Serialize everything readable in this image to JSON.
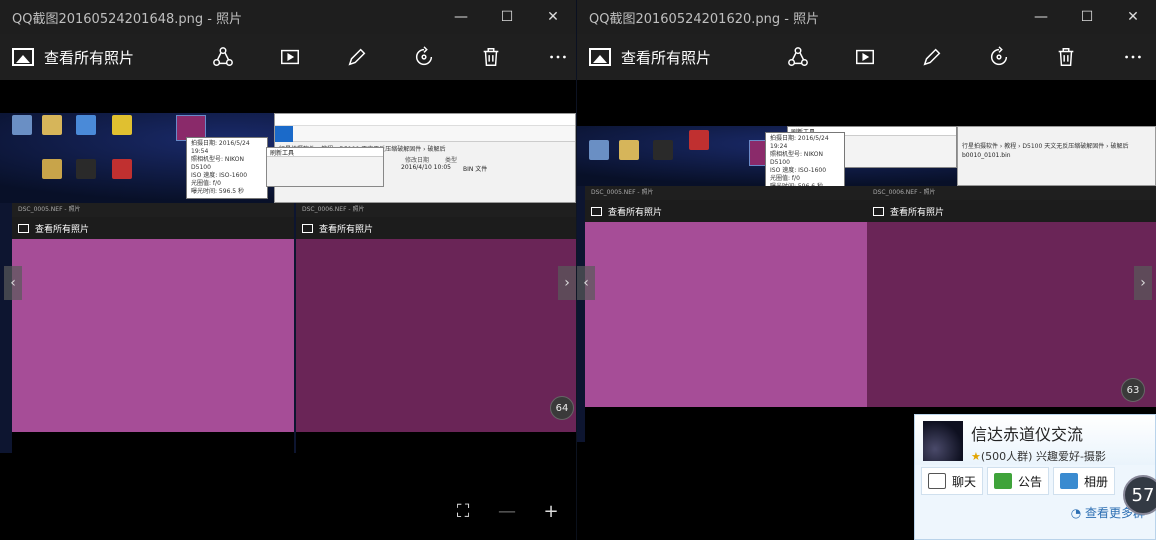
{
  "left_window": {
    "title": "QQ截图20160524201648.png - 照片",
    "all_photos_label": "查看所有照片",
    "counter": "64",
    "zoom_controls": [
      "fit-icon",
      "zoom-out-icon",
      "zoom-in-icon"
    ]
  },
  "right_window": {
    "title": "QQ截图20160524201620.png - 照片",
    "all_photos_label": "查看所有照片",
    "counter": "63"
  },
  "toolbar_icons": [
    "share-icon",
    "slideshow-icon",
    "edit-icon",
    "rotate-icon",
    "delete-icon",
    "more-icon"
  ],
  "embedded": {
    "left_info": [
      "拍摄日期: 2016/5/24 19:54",
      "照相机型号: NIKON D5100",
      "ISO 速度: ISO-1600",
      "光圈值: f/0",
      "曝光时间: 596.5 秒"
    ],
    "right_info": [
      "拍摄日期: 2016/5/24 19:24",
      "照相机型号: NIKON D5100",
      "ISO 速度: ISO-1600",
      "光圈值: f/0",
      "曝光时间: 596.6 秒"
    ],
    "mini_left_title": "DSC_0005.NEF - 照片",
    "mini_right_title": "DSC_0006.NEF - 照片",
    "mini_label": "查看所有照片",
    "explorer_path": "行星拍摄软件 › 教程 › D5100 天文无反压缩破解固件 › 破解后",
    "file_name": "b0010_0101.bin",
    "file_date": "2016/4/10 10:05",
    "file_type": "BIN 文件",
    "file_col_date": "修改日期",
    "file_col_type": "类型",
    "dialog_title": "刷新工具",
    "photo_color": "#a64d97",
    "photo_color_dark": "#6a2557"
  },
  "qq_popup": {
    "group_name": "信达赤道仪交流",
    "member_info": "(500人群) 兴趣爱好-摄影",
    "tabs": [
      "聊天",
      "公告",
      "相册"
    ],
    "more_link": "查看更多群",
    "badge": "57"
  }
}
